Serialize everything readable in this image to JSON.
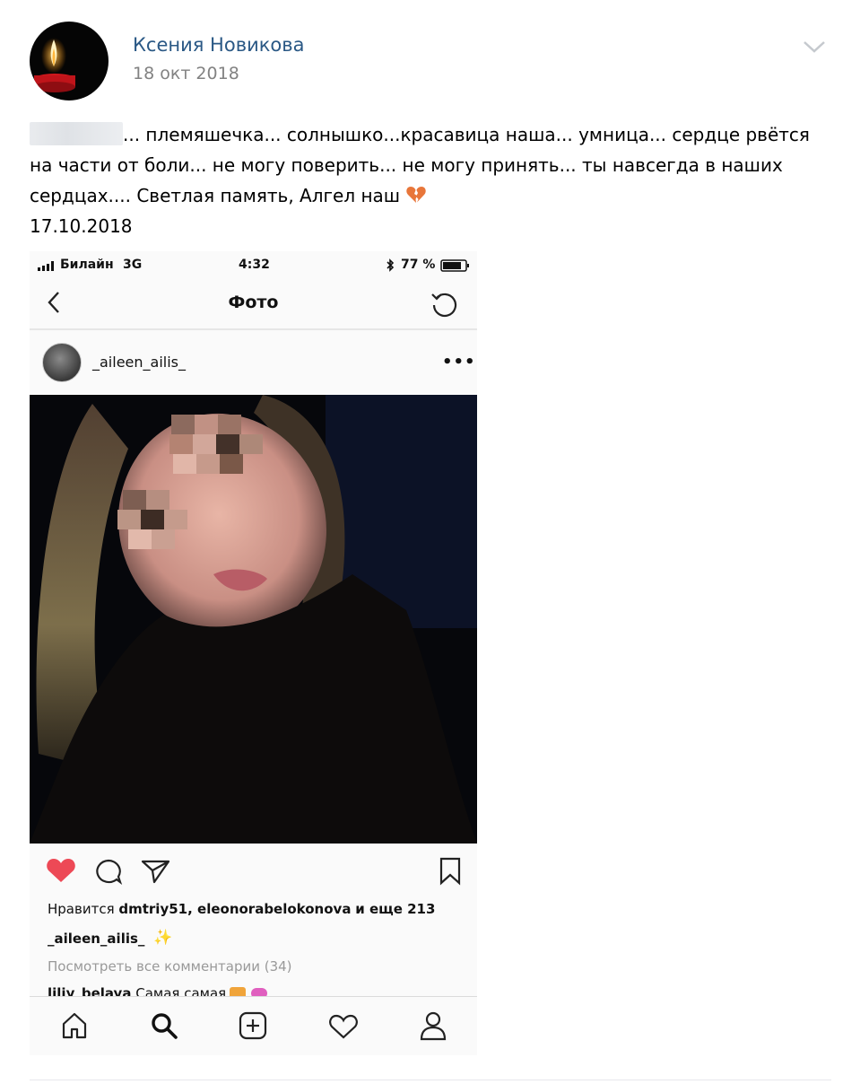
{
  "post": {
    "author": "Ксения Новикова",
    "date": "18 окт 2018",
    "text_part1": "... племяшечка... солнышко...красавица наша... умница... сердце рвётся на части от боли... не могу поверить... не могу принять... ты навсегда в наших сердцах.... Светлая память, Алгел наш",
    "text_date": "17.10.2018"
  },
  "phone": {
    "status": {
      "carrier": "Билайн",
      "network": "3G",
      "time": "4:32",
      "battery": "77 %"
    },
    "nav": {
      "title": "Фото"
    },
    "post_user": "_aileen_ailis_",
    "likes": {
      "prefix": "Нравится",
      "users": "dmtriy51, eleonorabelokonova",
      "suffix": "и еще 213"
    },
    "caption_user": "_aileen_ailis_",
    "view_comments": "Посмотреть все комментарии (34)",
    "comment": {
      "user": "liliy_belaya",
      "text": "Самая самая"
    }
  },
  "colors": {
    "link": "#2a5885",
    "meta": "#828282",
    "like_red": "#ed4956"
  },
  "icons": [
    "chevron-down-icon",
    "broken-heart-icon",
    "back-icon",
    "refresh-icon",
    "more-icon",
    "heart-icon",
    "comment-icon",
    "send-icon",
    "bookmark-icon",
    "home-icon",
    "search-icon",
    "add-icon",
    "activity-icon",
    "profile-icon"
  ]
}
